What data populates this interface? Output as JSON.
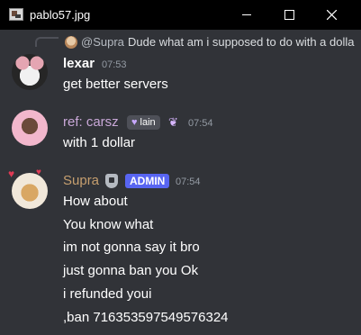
{
  "window": {
    "title": "pablo57.jpg"
  },
  "reply": {
    "username": "@Supra",
    "text": "Dude what am i supposed to do with a dolla"
  },
  "messages": [
    {
      "username": "lexar",
      "timestamp": "07:53",
      "lines": [
        "get better servers"
      ]
    },
    {
      "username": "ref: carsz",
      "tag": "lain",
      "timestamp": "07:54",
      "lines": [
        "with 1 dollar"
      ]
    },
    {
      "username": "Supra",
      "role_badge": "ADMIN",
      "timestamp": "07:54",
      "lines": [
        "How about",
        "You know what",
        "im not gonna say it bro",
        "just gonna ban you Ok",
        "i refunded youi",
        ",ban 716353597549576324"
      ]
    }
  ],
  "colors": {
    "background": "#313338",
    "titlebar": "#000000",
    "admin_badge": "#5865f2",
    "carsz_name": "#c9a8d8",
    "supra_name": "#c69f6f"
  }
}
